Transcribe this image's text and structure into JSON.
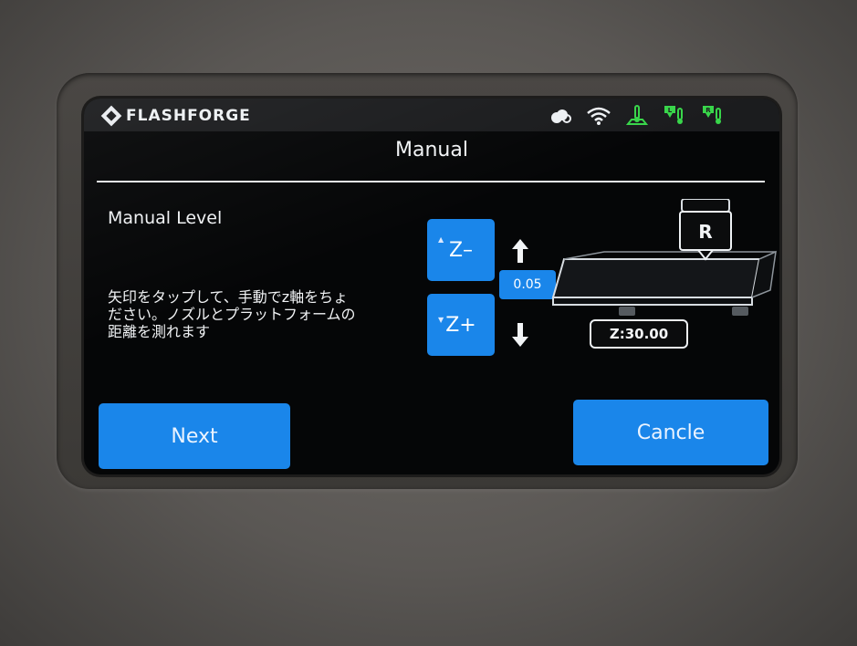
{
  "header": {
    "brand": "FLASHFORGE",
    "brand_logo_icon": "flashforge-logo-icon",
    "status_icons": [
      "cloud-icon",
      "wifi-icon",
      "bed-temperature-icon",
      "left-nozzle-temperature-icon",
      "right-nozzle-temperature-icon"
    ],
    "left_nozzle_badge": "L",
    "right_nozzle_badge": "R"
  },
  "page": {
    "title": "Manual"
  },
  "level": {
    "title": "Manual Level",
    "instruction": "矢印をタップして、手動でz軸をちょ\nださい。ノズルとプラットフォームの\n距離を測れます"
  },
  "controls": {
    "z_up_label": "Z–",
    "z_down_label": "Z+",
    "step_value": "0.05",
    "z_readout": "Z:30.00",
    "nozzle_label": "R"
  },
  "buttons": {
    "next": "Next",
    "cancel": "Cancle"
  },
  "colors": {
    "accent": "#1a86ea",
    "status_green": "#38d64a",
    "screen_bg": "#050607"
  }
}
